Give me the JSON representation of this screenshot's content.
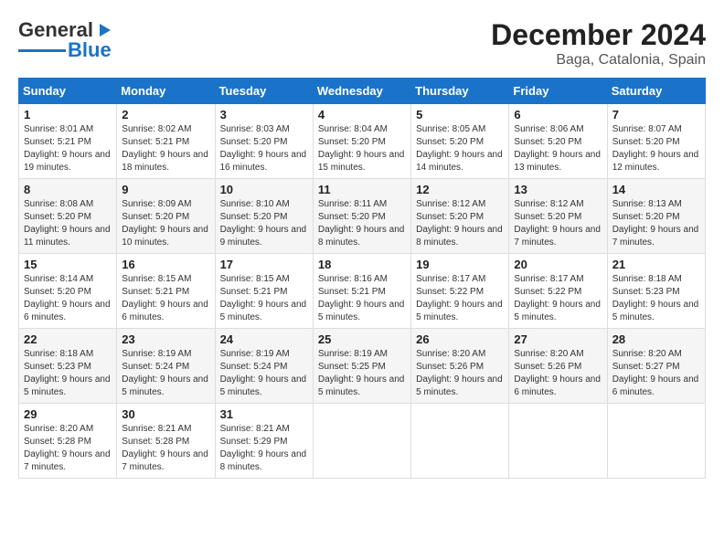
{
  "header": {
    "logo_line1": "General",
    "logo_line2": "Blue",
    "title": "December 2024",
    "subtitle": "Baga, Catalonia, Spain"
  },
  "days_of_week": [
    "Sunday",
    "Monday",
    "Tuesday",
    "Wednesday",
    "Thursday",
    "Friday",
    "Saturday"
  ],
  "weeks": [
    [
      {
        "day": "1",
        "sunrise": "8:01 AM",
        "sunset": "5:21 PM",
        "daylight": "9 hours and 19 minutes."
      },
      {
        "day": "2",
        "sunrise": "8:02 AM",
        "sunset": "5:21 PM",
        "daylight": "9 hours and 18 minutes."
      },
      {
        "day": "3",
        "sunrise": "8:03 AM",
        "sunset": "5:20 PM",
        "daylight": "9 hours and 16 minutes."
      },
      {
        "day": "4",
        "sunrise": "8:04 AM",
        "sunset": "5:20 PM",
        "daylight": "9 hours and 15 minutes."
      },
      {
        "day": "5",
        "sunrise": "8:05 AM",
        "sunset": "5:20 PM",
        "daylight": "9 hours and 14 minutes."
      },
      {
        "day": "6",
        "sunrise": "8:06 AM",
        "sunset": "5:20 PM",
        "daylight": "9 hours and 13 minutes."
      },
      {
        "day": "7",
        "sunrise": "8:07 AM",
        "sunset": "5:20 PM",
        "daylight": "9 hours and 12 minutes."
      }
    ],
    [
      {
        "day": "8",
        "sunrise": "8:08 AM",
        "sunset": "5:20 PM",
        "daylight": "9 hours and 11 minutes."
      },
      {
        "day": "9",
        "sunrise": "8:09 AM",
        "sunset": "5:20 PM",
        "daylight": "9 hours and 10 minutes."
      },
      {
        "day": "10",
        "sunrise": "8:10 AM",
        "sunset": "5:20 PM",
        "daylight": "9 hours and 9 minutes."
      },
      {
        "day": "11",
        "sunrise": "8:11 AM",
        "sunset": "5:20 PM",
        "daylight": "9 hours and 8 minutes."
      },
      {
        "day": "12",
        "sunrise": "8:12 AM",
        "sunset": "5:20 PM",
        "daylight": "9 hours and 8 minutes."
      },
      {
        "day": "13",
        "sunrise": "8:12 AM",
        "sunset": "5:20 PM",
        "daylight": "9 hours and 7 minutes."
      },
      {
        "day": "14",
        "sunrise": "8:13 AM",
        "sunset": "5:20 PM",
        "daylight": "9 hours and 7 minutes."
      }
    ],
    [
      {
        "day": "15",
        "sunrise": "8:14 AM",
        "sunset": "5:20 PM",
        "daylight": "9 hours and 6 minutes."
      },
      {
        "day": "16",
        "sunrise": "8:15 AM",
        "sunset": "5:21 PM",
        "daylight": "9 hours and 6 minutes."
      },
      {
        "day": "17",
        "sunrise": "8:15 AM",
        "sunset": "5:21 PM",
        "daylight": "9 hours and 5 minutes."
      },
      {
        "day": "18",
        "sunrise": "8:16 AM",
        "sunset": "5:21 PM",
        "daylight": "9 hours and 5 minutes."
      },
      {
        "day": "19",
        "sunrise": "8:17 AM",
        "sunset": "5:22 PM",
        "daylight": "9 hours and 5 minutes."
      },
      {
        "day": "20",
        "sunrise": "8:17 AM",
        "sunset": "5:22 PM",
        "daylight": "9 hours and 5 minutes."
      },
      {
        "day": "21",
        "sunrise": "8:18 AM",
        "sunset": "5:23 PM",
        "daylight": "9 hours and 5 minutes."
      }
    ],
    [
      {
        "day": "22",
        "sunrise": "8:18 AM",
        "sunset": "5:23 PM",
        "daylight": "9 hours and 5 minutes."
      },
      {
        "day": "23",
        "sunrise": "8:19 AM",
        "sunset": "5:24 PM",
        "daylight": "9 hours and 5 minutes."
      },
      {
        "day": "24",
        "sunrise": "8:19 AM",
        "sunset": "5:24 PM",
        "daylight": "9 hours and 5 minutes."
      },
      {
        "day": "25",
        "sunrise": "8:19 AM",
        "sunset": "5:25 PM",
        "daylight": "9 hours and 5 minutes."
      },
      {
        "day": "26",
        "sunrise": "8:20 AM",
        "sunset": "5:26 PM",
        "daylight": "9 hours and 5 minutes."
      },
      {
        "day": "27",
        "sunrise": "8:20 AM",
        "sunset": "5:26 PM",
        "daylight": "9 hours and 6 minutes."
      },
      {
        "day": "28",
        "sunrise": "8:20 AM",
        "sunset": "5:27 PM",
        "daylight": "9 hours and 6 minutes."
      }
    ],
    [
      {
        "day": "29",
        "sunrise": "8:20 AM",
        "sunset": "5:28 PM",
        "daylight": "9 hours and 7 minutes."
      },
      {
        "day": "30",
        "sunrise": "8:21 AM",
        "sunset": "5:28 PM",
        "daylight": "9 hours and 7 minutes."
      },
      {
        "day": "31",
        "sunrise": "8:21 AM",
        "sunset": "5:29 PM",
        "daylight": "9 hours and 8 minutes."
      },
      null,
      null,
      null,
      null
    ]
  ],
  "labels": {
    "sunrise": "Sunrise:",
    "sunset": "Sunset:",
    "daylight": "Daylight:"
  }
}
